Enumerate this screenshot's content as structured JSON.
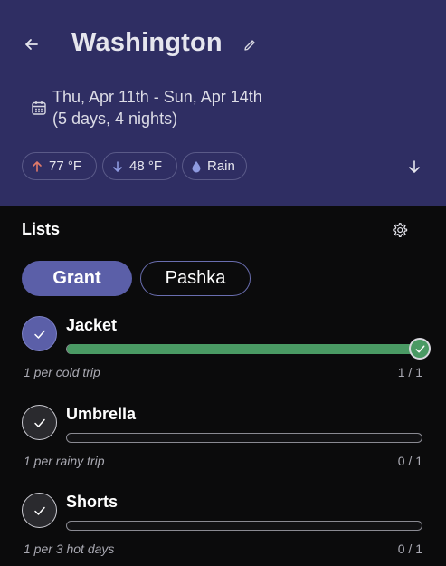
{
  "header": {
    "title": "Washington",
    "dates_line1": "Thu, Apr 11th - Sun, Apr 14th",
    "dates_line2": "(5 days, 4 nights)",
    "chips": {
      "high": "77 °F",
      "low": "48 °F",
      "weather": "Rain"
    },
    "colors": {
      "background": "#2f2e63",
      "high_arrow": "#e07a6a",
      "low_arrow": "#8e9ae0",
      "rain_drop": "#8e9ae0"
    },
    "icons": [
      "arrow-left-icon",
      "pencil-icon",
      "calendar-icon",
      "arrow-up-icon",
      "arrow-down-icon",
      "raindrop-icon",
      "arrow-down-icon"
    ]
  },
  "lists": {
    "title": "Lists",
    "tabs": [
      {
        "label": "Grant",
        "active": true
      },
      {
        "label": "Pashka",
        "active": false
      }
    ],
    "items": [
      {
        "name": "Jacket",
        "note": "1 per cold trip",
        "count": "1 / 1",
        "done": true,
        "progress": 1.0
      },
      {
        "name": "Umbrella",
        "note": "1 per rainy trip",
        "count": "0 / 1",
        "done": false,
        "progress": 0.0
      },
      {
        "name": "Shorts",
        "note": "1 per 3 hot days",
        "count": "0 / 1",
        "done": false,
        "progress": 0.0
      }
    ],
    "colors": {
      "accent": "#5b5fa8",
      "progress": "#4a9a64"
    }
  }
}
